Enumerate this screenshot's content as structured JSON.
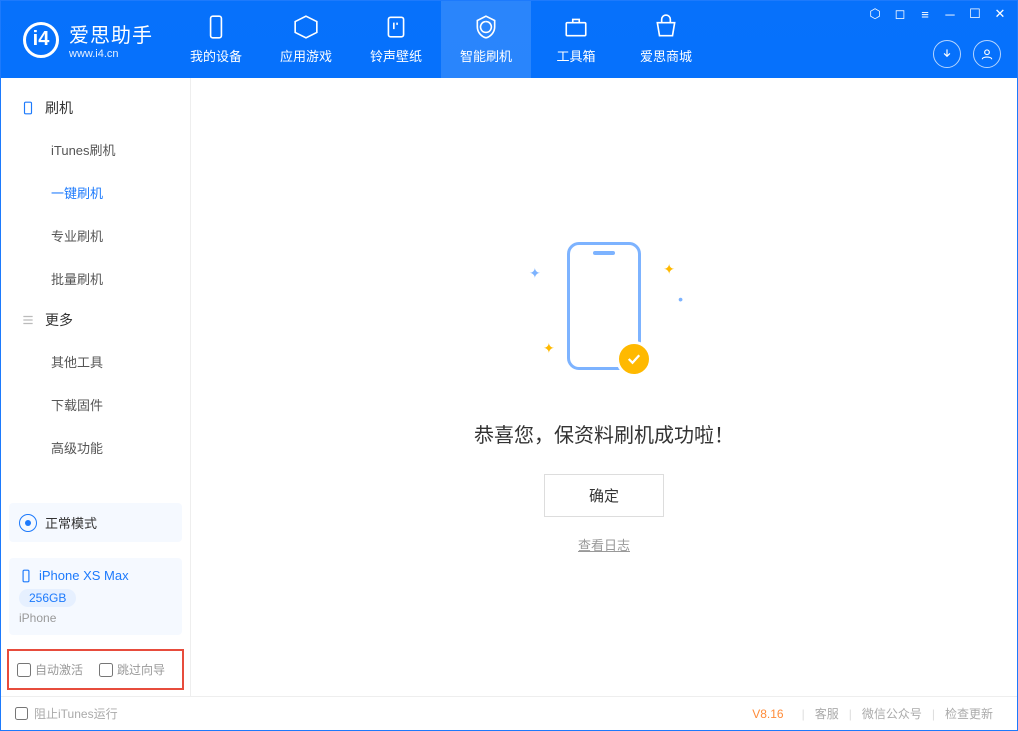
{
  "app": {
    "name": "爱思助手",
    "site": "www.i4.cn"
  },
  "nav": {
    "items": [
      {
        "label": "我的设备"
      },
      {
        "label": "应用游戏"
      },
      {
        "label": "铃声壁纸"
      },
      {
        "label": "智能刷机"
      },
      {
        "label": "工具箱"
      },
      {
        "label": "爱思商城"
      }
    ]
  },
  "sidebar": {
    "section1": {
      "title": "刷机",
      "items": [
        "iTunes刷机",
        "一键刷机",
        "专业刷机",
        "批量刷机"
      ],
      "activeIndex": 1
    },
    "section2": {
      "title": "更多",
      "items": [
        "其他工具",
        "下载固件",
        "高级功能"
      ]
    },
    "mode": "正常模式",
    "device": {
      "name": "iPhone XS Max",
      "capacity": "256GB",
      "type": "iPhone"
    },
    "options": {
      "autoActivate": "自动激活",
      "skipGuide": "跳过向导"
    }
  },
  "main": {
    "successText": "恭喜您，保资料刷机成功啦！",
    "okButton": "确定",
    "viewLog": "查看日志"
  },
  "footer": {
    "blockItunes": "阻止iTunes运行",
    "version": "V8.16",
    "links": [
      "客服",
      "微信公众号",
      "检查更新"
    ]
  }
}
